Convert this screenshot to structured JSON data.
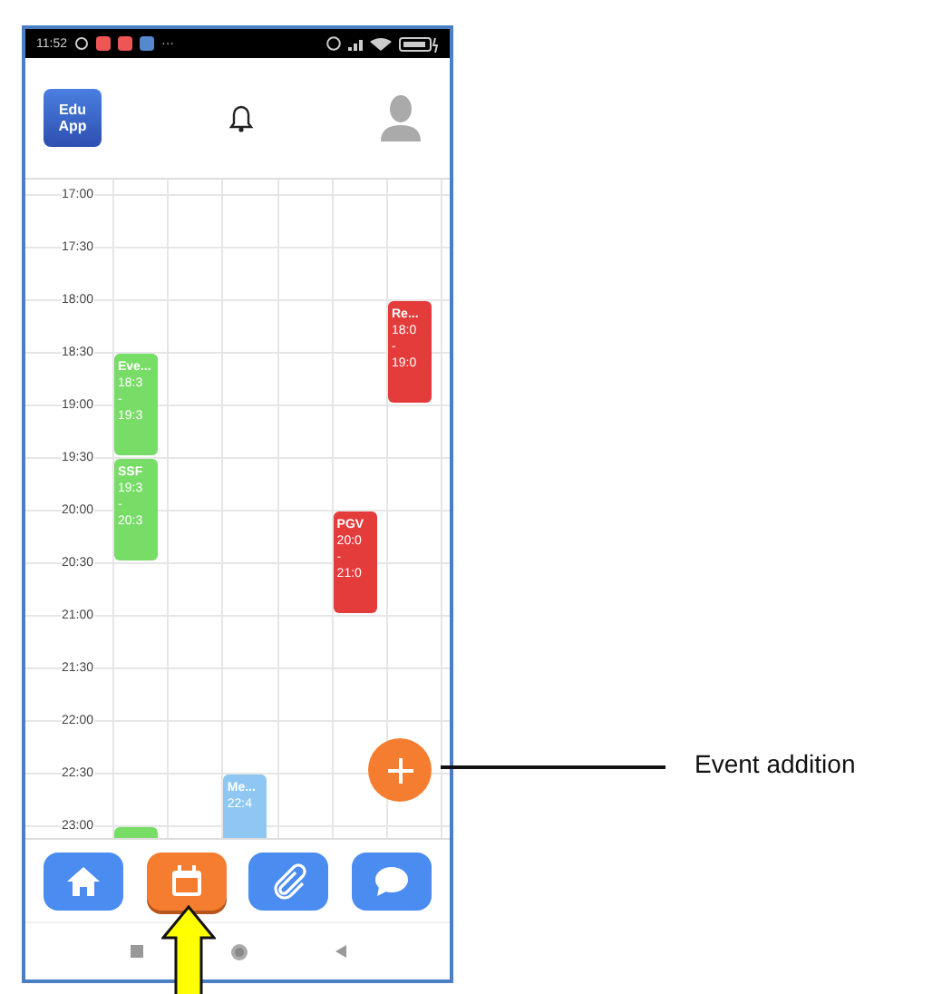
{
  "status_bar": {
    "time": "11:52",
    "more": "···"
  },
  "header": {
    "logo": [
      "Edu",
      "App"
    ]
  },
  "calendar": {
    "rows": [
      {
        "time": "17:00"
      },
      {
        "time": "17:30"
      },
      {
        "time": "18:00",
        "cells": [
          null,
          null,
          null,
          null,
          null,
          {
            "title": "Re...",
            "start": "18:0",
            "dash": "-",
            "end": "19:0",
            "color": "#e43b3b"
          }
        ]
      },
      {
        "time": "18:30",
        "cells": [
          {
            "title": "Eve...",
            "start": "18:3",
            "dash": "-",
            "end": "19:3",
            "color": "#77dd66"
          },
          null,
          null,
          null,
          null,
          null
        ]
      },
      {
        "time": "19:00"
      },
      {
        "time": "19:30",
        "cells": [
          {
            "title": "SSF",
            "start": "19:3",
            "dash": "-",
            "end": "20:3",
            "color": "#77dd66"
          },
          null,
          null,
          null,
          null,
          null
        ]
      },
      {
        "time": "20:00",
        "cells": [
          null,
          null,
          null,
          null,
          {
            "title": "PGV",
            "start": "20:0",
            "dash": "-",
            "end": "21:0",
            "color": "#e43b3b"
          },
          null
        ]
      },
      {
        "time": "20:30"
      },
      {
        "time": "21:00"
      },
      {
        "time": "21:30"
      },
      {
        "time": "22:00"
      },
      {
        "time": "22:30",
        "cells": [
          null,
          null,
          {
            "title": "Me...",
            "start": "22:4",
            "color": "#8ec8f2"
          },
          null,
          null,
          null
        ]
      },
      {
        "time": "23:00",
        "cells": [
          {
            "color": "#77dd66"
          },
          null,
          null,
          null,
          null,
          null
        ]
      }
    ]
  },
  "nav": [
    {
      "kind": "home",
      "selected": false
    },
    {
      "kind": "calendar",
      "selected": true
    },
    {
      "kind": "attachment",
      "selected": false
    },
    {
      "kind": "chat",
      "selected": false
    }
  ],
  "annotation": {
    "label": "Event addition"
  }
}
